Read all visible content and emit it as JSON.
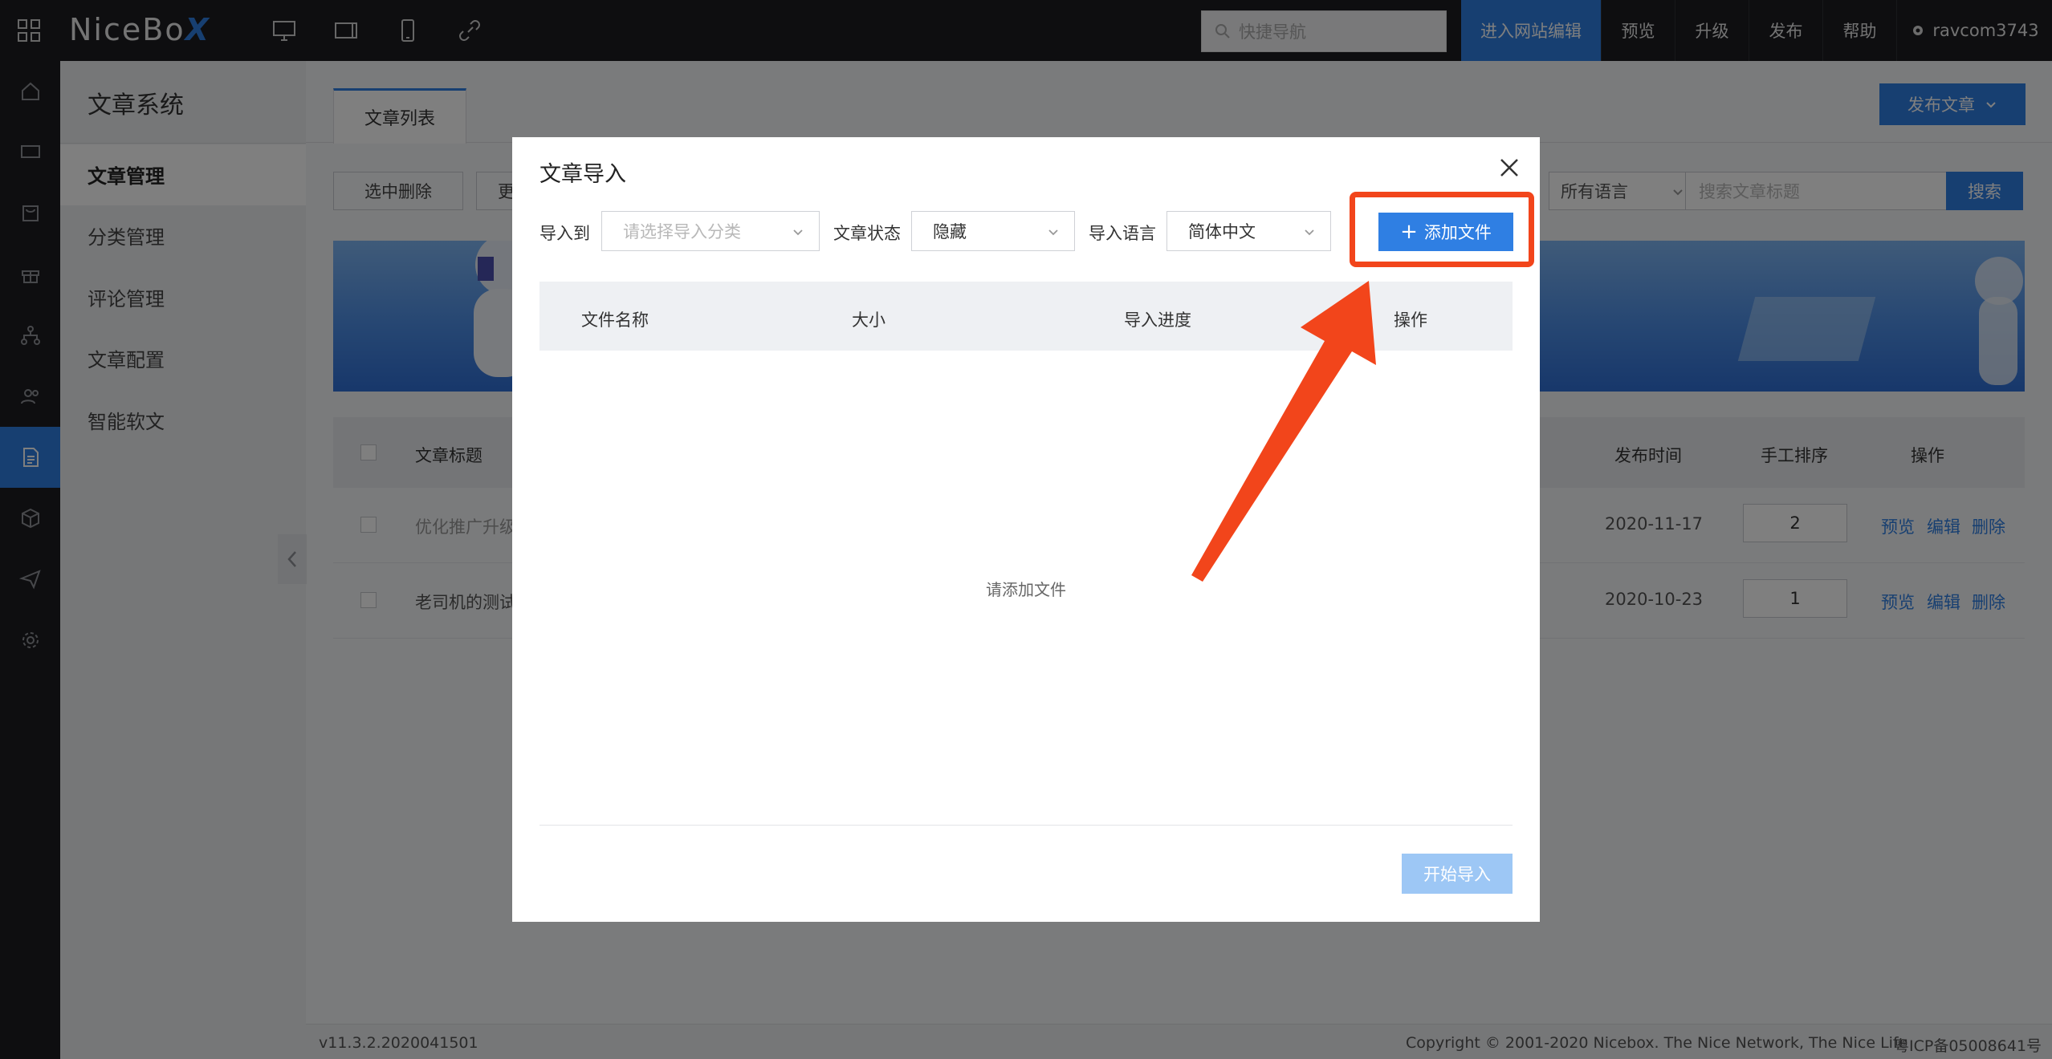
{
  "topbar": {
    "logo_text": "NiceBo",
    "logo_x": "X",
    "search_placeholder": "快捷导航",
    "buttons": {
      "edit_site": "进入网站编辑",
      "preview": "预览",
      "upgrade": "升级",
      "publish": "发布",
      "help": "帮助",
      "user": "ravcom3743"
    }
  },
  "rail": {
    "icons": [
      "home-icon",
      "monitor-icon",
      "store-icon",
      "gift-icon",
      "sitemap-icon",
      "users-icon",
      "article-icon",
      "box-icon",
      "send-icon",
      "settings-icon"
    ],
    "active_index": 6
  },
  "subnav": {
    "title": "文章系统",
    "items": [
      "文章管理",
      "分类管理",
      "评论管理",
      "文章配置",
      "智能软文"
    ],
    "active_index": 0
  },
  "main": {
    "tab": "文章列表",
    "publish_button": "发布文章",
    "toolbar": {
      "delete_selected": "选中删除",
      "more": "更",
      "language_select": "所有语言",
      "search_placeholder": "搜索文章标题",
      "search_button": "搜索"
    },
    "table": {
      "headers": {
        "title": "文章标题",
        "publish_time": "发布时间",
        "manual_order": "手工排序",
        "actions": "操作"
      },
      "rows": [
        {
          "title": "优化推广升级",
          "date": "2020-11-17",
          "order": "2"
        },
        {
          "title": "老司机的测试",
          "date": "2020-10-23",
          "order": "1"
        }
      ],
      "row_actions": {
        "preview": "预览",
        "edit": "编辑",
        "delete": "删除"
      }
    },
    "footer": {
      "version": "v11.3.2.2020041501",
      "copyright": "Copyright © 2001-2020 Nicebox. The Nice Network, The Nice Life",
      "icp": "粤ICP备05008641号"
    }
  },
  "modal": {
    "title": "文章导入",
    "import_to_label": "导入到",
    "import_to_placeholder": "请选择导入分类",
    "status_label": "文章状态",
    "status_value": "隐藏",
    "language_label": "导入语言",
    "language_value": "简体中文",
    "add_file_button": "添加文件",
    "add_file_plus": "+",
    "file_table_headers": {
      "name": "文件名称",
      "size": "大小",
      "progress": "导入进度",
      "actions": "操作"
    },
    "empty_text": "请添加文件",
    "start_button": "开始导入"
  },
  "colors": {
    "accent": "#2f7fe3",
    "highlight": "#f2451b",
    "topbar_bg": "#1c1d21"
  }
}
